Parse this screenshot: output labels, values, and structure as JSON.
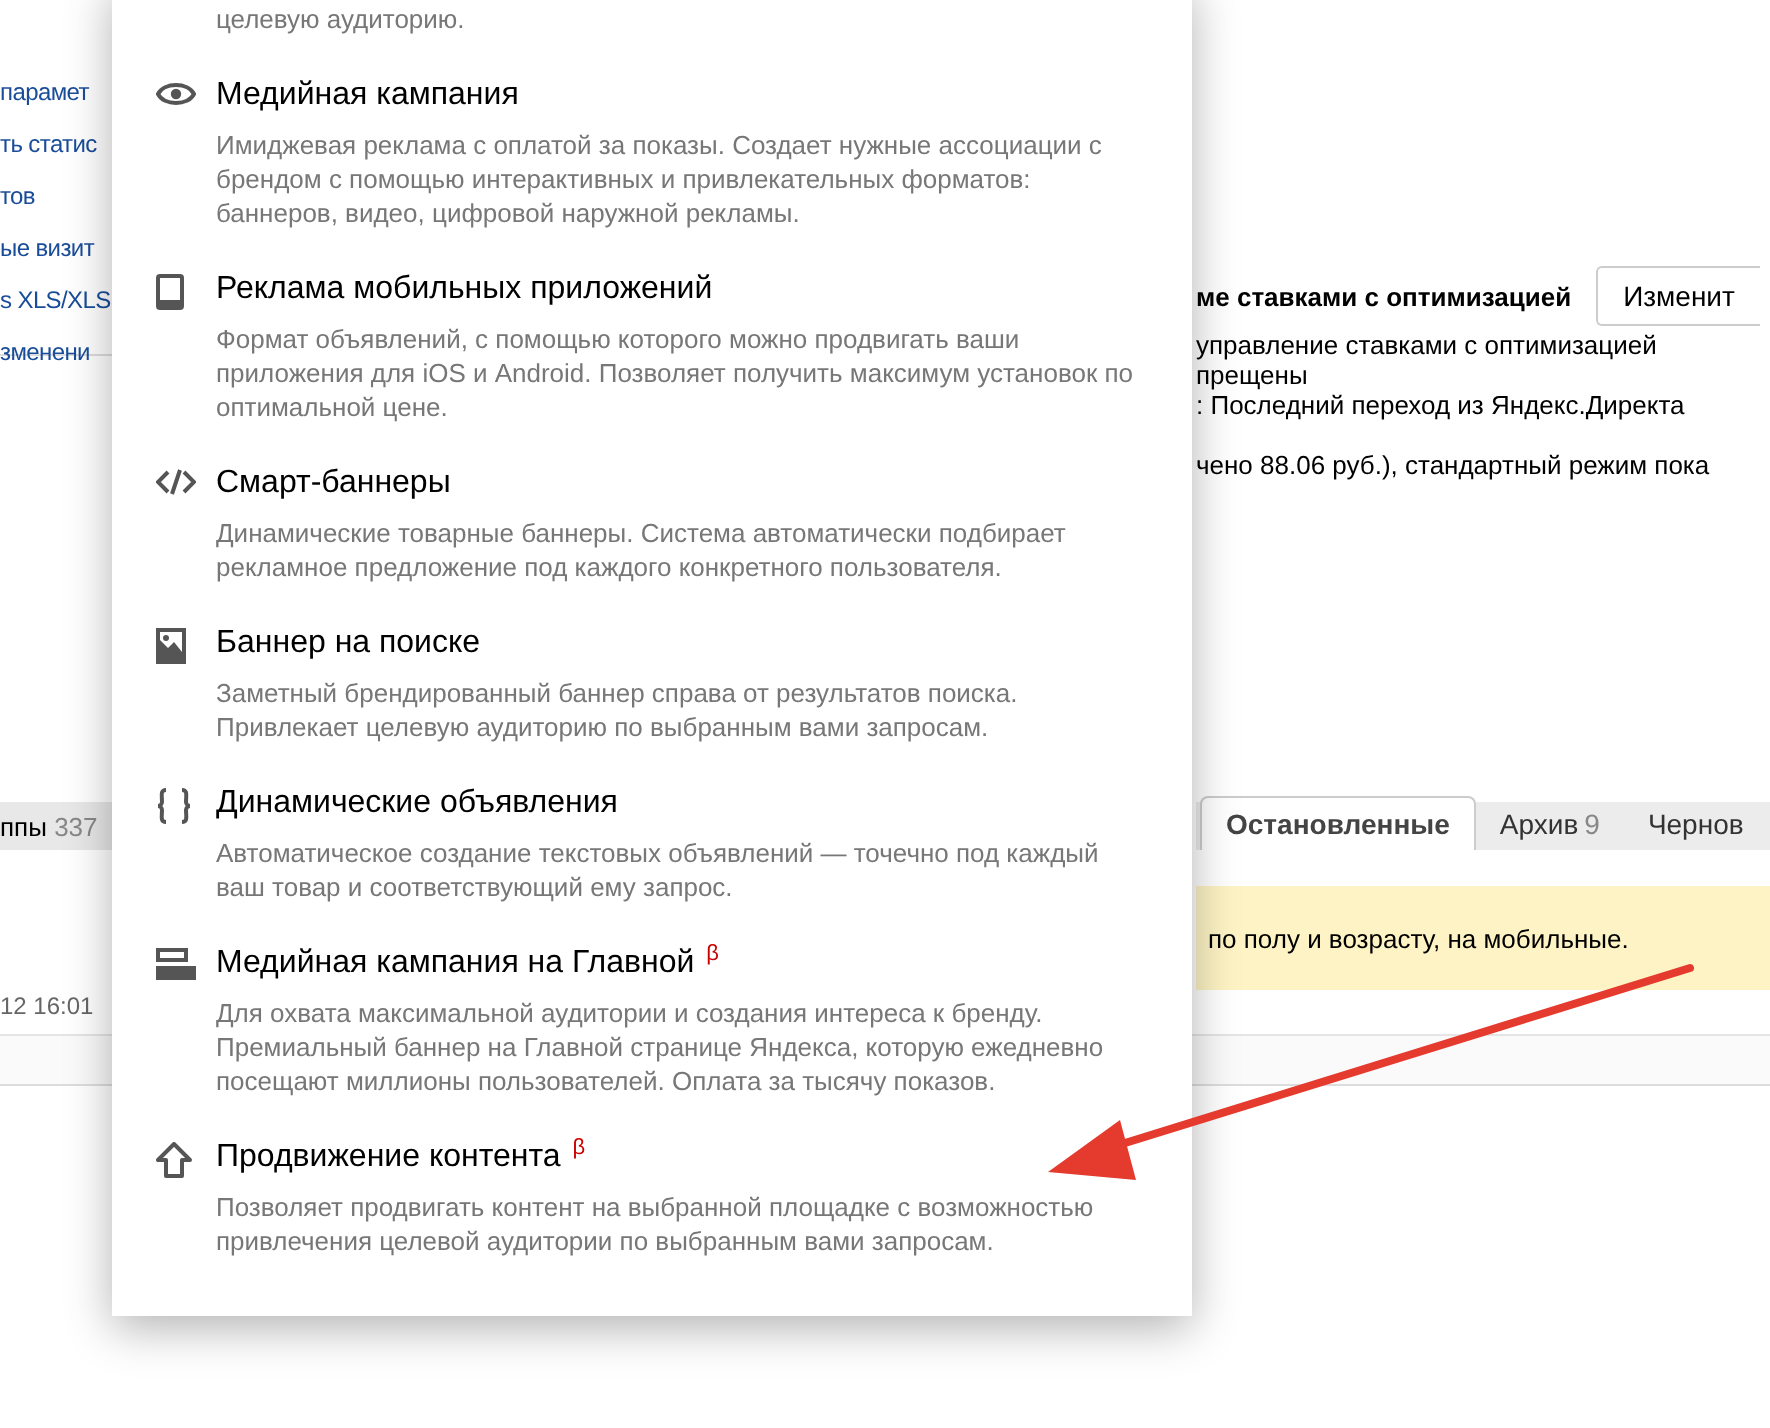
{
  "background": {
    "left_links": [
      "парамет",
      "ть статис",
      "тов",
      "ые визит",
      "s XLS/XLS",
      "зменени"
    ],
    "strategy": {
      "title": "ме ставками с оптимизацией",
      "change_button": "Изменит",
      "lines": [
        "управление ставками с оптимизацией",
        "прещены",
        ": Последний переход из Яндекс.Директа"
      ],
      "summary": "чено 88.06 руб.), стандартный режим пока"
    },
    "groups_tab": {
      "label": "ппы",
      "count": "337"
    },
    "tabs": [
      {
        "label": "Остановленные",
        "selected": true
      },
      {
        "label": "Архив",
        "count": "9",
        "selected": false
      },
      {
        "label": "Чернов",
        "selected": false
      }
    ],
    "notice": "по полу и возрасту, на мобильные.",
    "date": "12 16:01"
  },
  "menu": {
    "cut_description": "целевую аудиторию.",
    "items": [
      {
        "kind": "eye",
        "title": "Медийная кампания",
        "description": "Имиджевая реклама с оплатой за показы. Создает нужные ассоциации с брендом с помощью интерактивных и привлекательных форматов: баннеров, видео, цифровой наружной рекламы."
      },
      {
        "kind": "phone",
        "title": "Реклама мобильных приложений",
        "description": "Формат объявлений, с помощью которого можно продвигать ваши приложения для iOS и Android. Позволяет получить максимум установок по оптимальной цене."
      },
      {
        "kind": "code",
        "title": "Смарт-баннеры",
        "description": "Динамические товарные баннеры. Система автоматически подбирает рекламное предложение под каждого конкретного пользователя."
      },
      {
        "kind": "image",
        "title": "Баннер на поиске",
        "description": "Заметный брендированный баннер справа от результатов поиска. Привлекает целевую аудиторию по выбранным вами запросам."
      },
      {
        "kind": "braces",
        "title": "Динамические объявления",
        "description": "Автоматическое создание текстовых объявлений — точечно под каждый ваш товар и соответствующий ему запрос."
      },
      {
        "kind": "banner",
        "title": "Медийная кампания на Главной",
        "badge": "β",
        "description": "Для охвата максимальной аудитории и создания интереса к бренду. Премиальный баннер на Главной странице Яндекса, которую ежедневно посещают миллионы пользователей. Оплата за тысячу показов."
      },
      {
        "kind": "up",
        "title": "Продвижение контента",
        "badge": "β",
        "description": "Позволяет продвигать контент на выбранной площадке с возможностью привлечения целевой аудитории по выбранным вами запросам."
      }
    ]
  }
}
